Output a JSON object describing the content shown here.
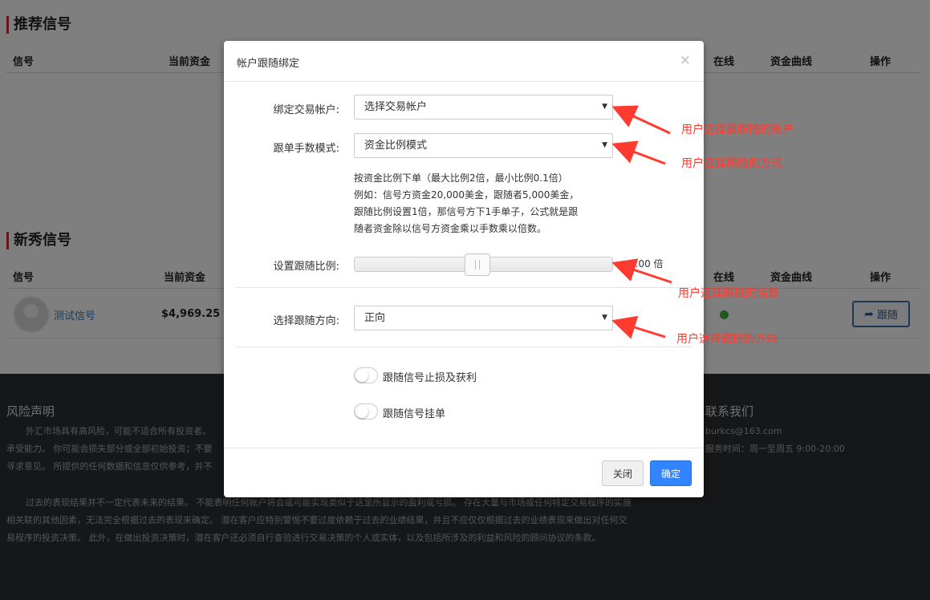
{
  "page": {
    "recommended": {
      "title": "推荐信号",
      "headers": {
        "signal": "信号",
        "fund": "当前资金",
        "online": "在线",
        "curve": "资金曲线",
        "action": "操作"
      }
    },
    "newbie": {
      "title": "新秀信号",
      "headers": {
        "signal": "信号",
        "fund": "当前资金",
        "online": "在线",
        "curve": "资金曲线",
        "action": "操作"
      },
      "rows": [
        {
          "name": "测试信号",
          "fund": "$4,969.25",
          "follow_label": "跟随"
        }
      ]
    },
    "footer": {
      "risk_title": "风险声明",
      "risk_lines": [
        "外汇市场具有高风险，可能不适合所有投资者。",
        "承受能力。 你可能会损失部分或全部初始投资；不要",
        "寻求意见。 所提供的任何数据和信息仅供参考，并不"
      ],
      "past_lines": [
        "过去的表现结果并不一定代表未来的结果。 不能表明任何帐户将会或可能实现类似于这里所显示的盈利或亏损。 存在大量与市场或任何特定交易程序的实施",
        "相关联的其他因素，无法完全根据过去的表现来确定。 潜在客户应特别警惕不要过度依赖于过去的业绩结果，并且不应仅仅根据过去的业绩表现来做出对任何交",
        "易程序的投资决策。 此外，在做出投资决策时，潜在客户还必须自行查验进行交易决策的个人或实体，以及包括所涉及的利益和风险的顾问协议的条款。"
      ],
      "contact_title": "联系我们",
      "email": "burkcs@163.com",
      "service_time": "服务时间：周一至周五 9:00-20:00"
    }
  },
  "modal": {
    "title": "帐户跟随绑定",
    "close_symbol": "×",
    "account": {
      "label": "绑定交易帐户:",
      "value": "选择交易帐户"
    },
    "mode": {
      "label": "跟单手数模式:",
      "value": "资金比例模式"
    },
    "description": [
      "按资金比例下单（最大比例2倍，最小比例0.1倍）",
      "例如：信号方资金20,000美金，跟随者5,000美金，",
      "跟随比例设置1倍，那信号方下1手单子，公式就是跟",
      "随者资金除以信号方资金乘以手数乘以倍数。"
    ],
    "ratio": {
      "label": "设置跟随比例:",
      "value": 1.0,
      "min": 0.1,
      "max": 2,
      "value_text": "1.00 倍"
    },
    "direction": {
      "label": "选择跟随方向:",
      "value": "正向"
    },
    "toggles": [
      {
        "label": "跟随信号止损及获利",
        "on": false
      },
      {
        "label": "跟随信号挂单",
        "on": false
      }
    ],
    "buttons": {
      "close": "关闭",
      "ok": "确定"
    }
  },
  "annotations": {
    "account": "用户选择要跟随的帐户",
    "mode": "用户选择跟随的方式",
    "ratio": "用户选择跟随的倍数",
    "direction": "用户选择跟随的方向"
  },
  "colors": {
    "accent": "#3385ff",
    "annotation": "#ff3b30",
    "online": "#3fb23f",
    "section_bar": "#c9302c"
  }
}
